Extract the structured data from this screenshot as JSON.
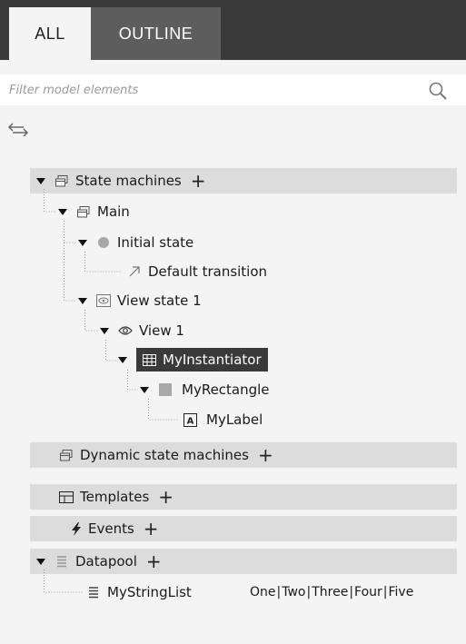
{
  "tabs": [
    {
      "label": "ALL",
      "active": true
    },
    {
      "label": "OUTLINE",
      "active": false
    }
  ],
  "filter": {
    "placeholder": "Filter model elements",
    "value": ""
  },
  "tree": {
    "state_machines": {
      "label": "State machines",
      "main": {
        "label": "Main",
        "initial_state": {
          "label": "Initial state",
          "default_transition": "Default transition"
        },
        "view_state": {
          "label": "View state 1",
          "view": {
            "label": "View 1",
            "instantiator": {
              "label": "MyInstantiator",
              "rectangle": {
                "label": "MyRectangle",
                "label_widget": "MyLabel"
              }
            }
          }
        }
      }
    },
    "dynamic_state_machines": {
      "label": "Dynamic state machines"
    },
    "templates": {
      "label": "Templates"
    },
    "events": {
      "label": "Events"
    },
    "datapool": {
      "label": "Datapool",
      "items": [
        {
          "label": "MyStringList",
          "values": [
            "One",
            "Two",
            "Three",
            "Four",
            "Five"
          ]
        }
      ]
    }
  },
  "add_symbol": "+",
  "colors": {
    "tab_bar": "#3a3a3a",
    "active_tab": "#f4f4f4",
    "inactive_tab": "#5d5d5d",
    "section_bg": "#dcdcdc",
    "selection": "#3a3a3a",
    "background": "#f4f4f4"
  }
}
